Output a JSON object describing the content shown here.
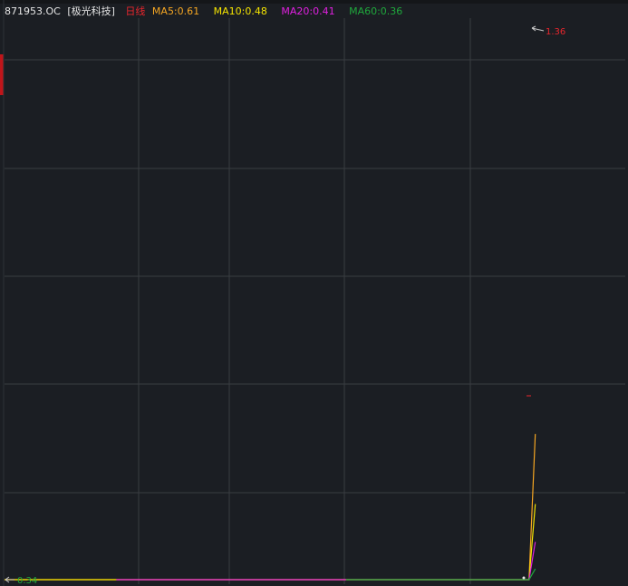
{
  "header": {
    "symbol": "871953.OC",
    "name": "[极光科技]",
    "period": "日线"
  },
  "colors": {
    "background": "#1b1e23",
    "grid": "#3a3d42",
    "price": "#f0f0f0",
    "period": "#e8262d",
    "ma5": "#f5a623",
    "ma10": "#f5e400",
    "ma20": "#e020e0",
    "ma60": "#1fa83c",
    "high_label": "#e8262d",
    "low_label": "#1fa83c"
  },
  "chart_data": {
    "type": "line",
    "legend_placement": "top-left",
    "grid": true,
    "price_annotations": {
      "high": "1.36",
      "low": "0.34"
    },
    "ylim": [
      0.34,
      1.36
    ],
    "series": [
      {
        "name": "MA5",
        "label": "MA5:0.61",
        "color": "#f5a623",
        "points": [
          [
            0,
            0.34
          ],
          [
            0.18,
            0.34
          ],
          [
            0.82,
            0.34
          ],
          [
            0.845,
            0.34
          ],
          [
            0.855,
            0.61
          ]
        ]
      },
      {
        "name": "MA10",
        "label": "MA10:0.48",
        "color": "#f5e400",
        "points": [
          [
            0,
            0.34
          ],
          [
            0.18,
            0.34
          ],
          [
            0.82,
            0.34
          ],
          [
            0.845,
            0.34
          ],
          [
            0.855,
            0.48
          ]
        ]
      },
      {
        "name": "MA20",
        "label": "MA20:0.41",
        "color": "#e020e0",
        "points": [
          [
            0.18,
            0.34
          ],
          [
            0.82,
            0.34
          ],
          [
            0.845,
            0.34
          ],
          [
            0.855,
            0.41
          ]
        ]
      },
      {
        "name": "MA60",
        "label": "MA60:0.36",
        "color": "#1fa83c",
        "points": [
          [
            0.55,
            0.34
          ],
          [
            0.82,
            0.34
          ],
          [
            0.845,
            0.34
          ],
          [
            0.855,
            0.36
          ]
        ]
      }
    ]
  }
}
